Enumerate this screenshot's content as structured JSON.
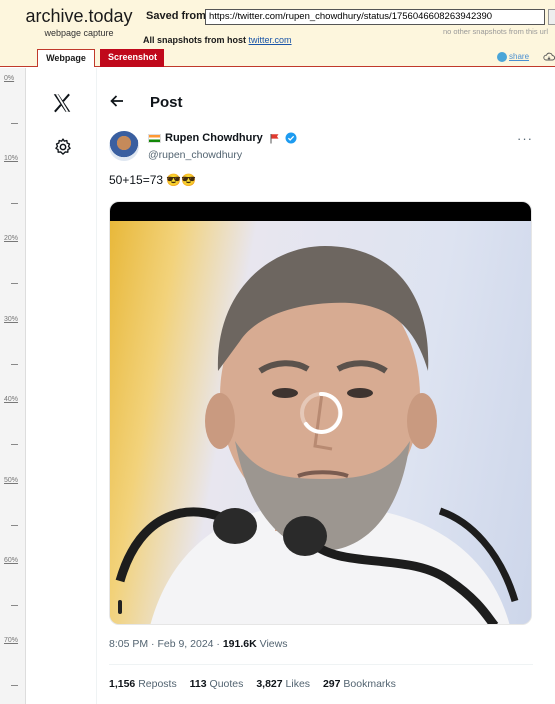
{
  "archive": {
    "brand_name": "archive.today",
    "brand_sub": "webpage capture",
    "saved_from_label": "Saved from",
    "url": "https://twitter.com/rupen_chowdhury/status/1756046608263942390",
    "no_other": "no other snapshots from this url",
    "all_snapshots_label": "All snapshots",
    "from_host_label": "from host",
    "host": "twitter.com",
    "tab_webpage": "Webpage",
    "tab_screenshot": "Screenshot",
    "share_label": "share",
    "accent_color": "#c0081b"
  },
  "ruler": {
    "labels": [
      "0%",
      "10%",
      "20%",
      "30%",
      "40%",
      "50%",
      "60%",
      "70%"
    ]
  },
  "nav": {
    "icons": [
      "x-logo-icon",
      "gear-icon"
    ]
  },
  "post": {
    "header_title": "Post",
    "author_name": "Rupen Chowdhury",
    "handle": "@rupen_chowdhury",
    "text": "50+15=73 😎😎",
    "time": "8:05 PM",
    "date": "Feb 9, 2024",
    "views_count": "191.6K",
    "views_label": "Views",
    "stats": {
      "reposts_count": "1,156",
      "reposts_label": "Reposts",
      "quotes_count": "113",
      "quotes_label": "Quotes",
      "likes_count": "3,827",
      "likes_label": "Likes",
      "bookmarks_count": "297",
      "bookmarks_label": "Bookmarks"
    },
    "verified_color": "#1d9bf0"
  }
}
